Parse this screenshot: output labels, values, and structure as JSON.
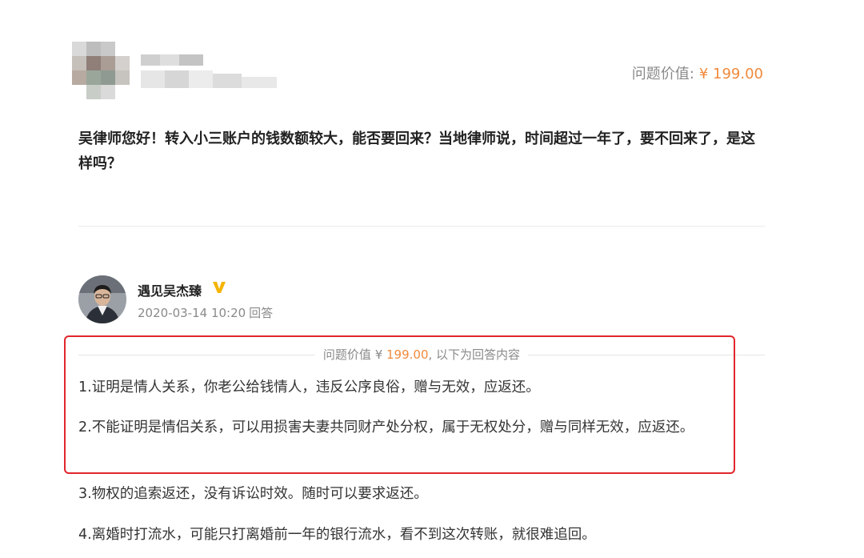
{
  "question": {
    "value_label": "问题价值:",
    "value_price": "¥ 199.00",
    "text": "吴律师您好！转入小三账户的钱数额较大，能否要回来？当地律师说，时间超过一年了，要不回来了，是这样吗？"
  },
  "answer": {
    "author_name": "遇见吴杰臻",
    "datetime": "2020-03-14 10:20",
    "datetime_suffix": "回答",
    "value_bar": {
      "prefix": "问题价值 ¥ ",
      "price": "199.00",
      "suffix": ", 以下为回答内容"
    },
    "paragraphs": [
      "1.证明是情人关系，你老公给钱情人，违反公序良俗，赠与无效，应返还。",
      "2.不能证明是情侣关系，可以用损害夫妻共同财产处分权，属于无权处分，赠与同样无效，应返还。",
      "3.物权的追索返还，没有诉讼时效。随时可以要求返还。",
      "4.离婚时打流水，可能只打离婚前一年的银行流水，看不到这次转账，就很难追回。"
    ]
  },
  "colors": {
    "accent_price": "#f08a3c",
    "highlight_box": "#e0262b",
    "verified_badge": "#f5b400"
  },
  "icons": {
    "asker_avatar": "pixelated-avatar",
    "verified": "verified-v-badge"
  }
}
